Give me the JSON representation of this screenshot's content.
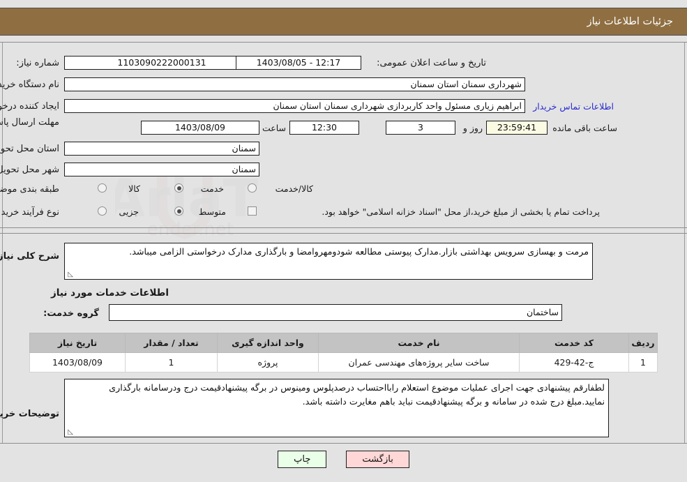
{
  "header": {
    "title": "جزئیات اطلاعات نیاز"
  },
  "form": {
    "need_number_label": "شماره نیاز:",
    "need_number_value": "1103090222000131",
    "announce_label": "تاریخ و ساعت اعلان عمومی:",
    "announce_value": "12:17 - 1403/08/05",
    "buyer_org_label": "نام دستگاه خریدار:",
    "buyer_org_value": "شهرداری سمنان استان سمنان",
    "creator_label": "ایجاد کننده درخواست:",
    "creator_value": "ابراهیم زیاری مسئول واحد کاربردازی شهرداری سمنان استان سمنان",
    "contact_link": "اطلاعات تماس خریدار",
    "deadline_label": "مهلت ارسال پاسخ: تا تاریخ:",
    "deadline_date": "1403/08/09",
    "hour_label": "ساعت",
    "deadline_time": "12:30",
    "days_value": "3",
    "days_label": "روز و",
    "timer_value": "23:59:41",
    "remaining_label": "ساعت باقی مانده",
    "province_label": "استان محل تحویل:",
    "province_value": "سمنان",
    "city_label": "شهر محل تحویل:",
    "city_value": "سمنان",
    "category_label": "طبقه بندی موضوعی:",
    "category_options": [
      "کالا",
      "خدمت",
      "کالا/خدمت"
    ],
    "category_selected": 1,
    "process_label": "نوع فرآیند خرید :",
    "process_options": [
      "جزیی",
      "متوسط"
    ],
    "process_selected": 1,
    "treasury_note": "پرداخت تمام یا بخشی از مبلغ خرید،از محل \"اسناد خزانه اسلامی\" خواهد بود.",
    "treasury_checked": false
  },
  "description": {
    "label": "شرح کلی نیاز:",
    "value": "مرمت و بهسازی سرویس بهداشتی بازار.مدارک پیوستی مطالعه شودومهروامضا و بارگذاری مدارک درخواستی الزامی میباشد."
  },
  "services": {
    "section_title": "اطلاعات خدمات مورد نیاز",
    "group_label": "گروه خدمت:",
    "group_value": "ساختمان",
    "columns": [
      "ردیف",
      "کد خدمت",
      "نام خدمت",
      "واحد اندازه گیری",
      "تعداد / مقدار",
      "تاریخ نیاز"
    ],
    "rows": [
      {
        "row": "1",
        "code": "ج-42-429",
        "name": "ساخت سایر پروژه‌های مهندسی عمران",
        "unit": "پروژه",
        "qty": "1",
        "date": "1403/08/09"
      }
    ]
  },
  "buyer_notes": {
    "label": "توضیحات خریدار:",
    "value": "لطفارقم پیشنهادی جهت اجرای عملیات موضوع استعلام رابااحتساب درصدپلوس ومینوس در برگه پیشنهادقیمت درج ودرسامانه بارگذاری نمایید.مبلغ درج شده در سامانه و برگه پیشنهادقیمت نباید باهم مغایرت داشته باشد."
  },
  "footer": {
    "print_label": "چاپ",
    "back_label": "بازگشت"
  },
  "colors": {
    "header_bg": "#8f6f42",
    "page_bg": "#e3e3e3",
    "link": "#2a2ad0",
    "timer_bg": "#fbfbe4",
    "print_btn_bg": "#eaffe8",
    "back_btn_bg": "#ffd7d7",
    "table_header_bg": "#c3c3c3"
  },
  "watermark": {
    "text": "AriaTender.net"
  }
}
